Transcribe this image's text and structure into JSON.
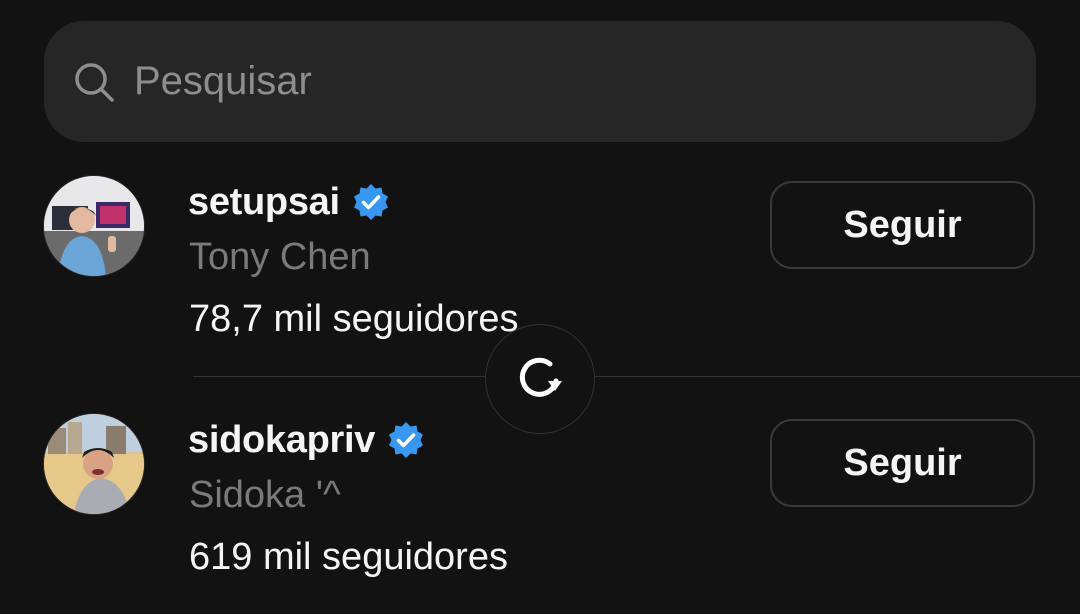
{
  "search": {
    "placeholder": "Pesquisar",
    "icon": "search-icon"
  },
  "users": [
    {
      "username": "setupsai",
      "verified": true,
      "full_name": "Tony Chen",
      "followers": "78,7 mil seguidores",
      "follow_label": "Seguir"
    },
    {
      "username": "sidokapriv",
      "verified": true,
      "full_name": "Sidoka '^",
      "followers": "619 mil seguidores",
      "follow_label": "Seguir"
    }
  ],
  "refresh": {
    "icon": "refresh-icon"
  },
  "colors": {
    "background": "#121212",
    "search_bg": "#262626",
    "verified_blue": "#3897f0",
    "secondary_text": "#7a7a7a",
    "button_border": "#3a3a3a"
  }
}
